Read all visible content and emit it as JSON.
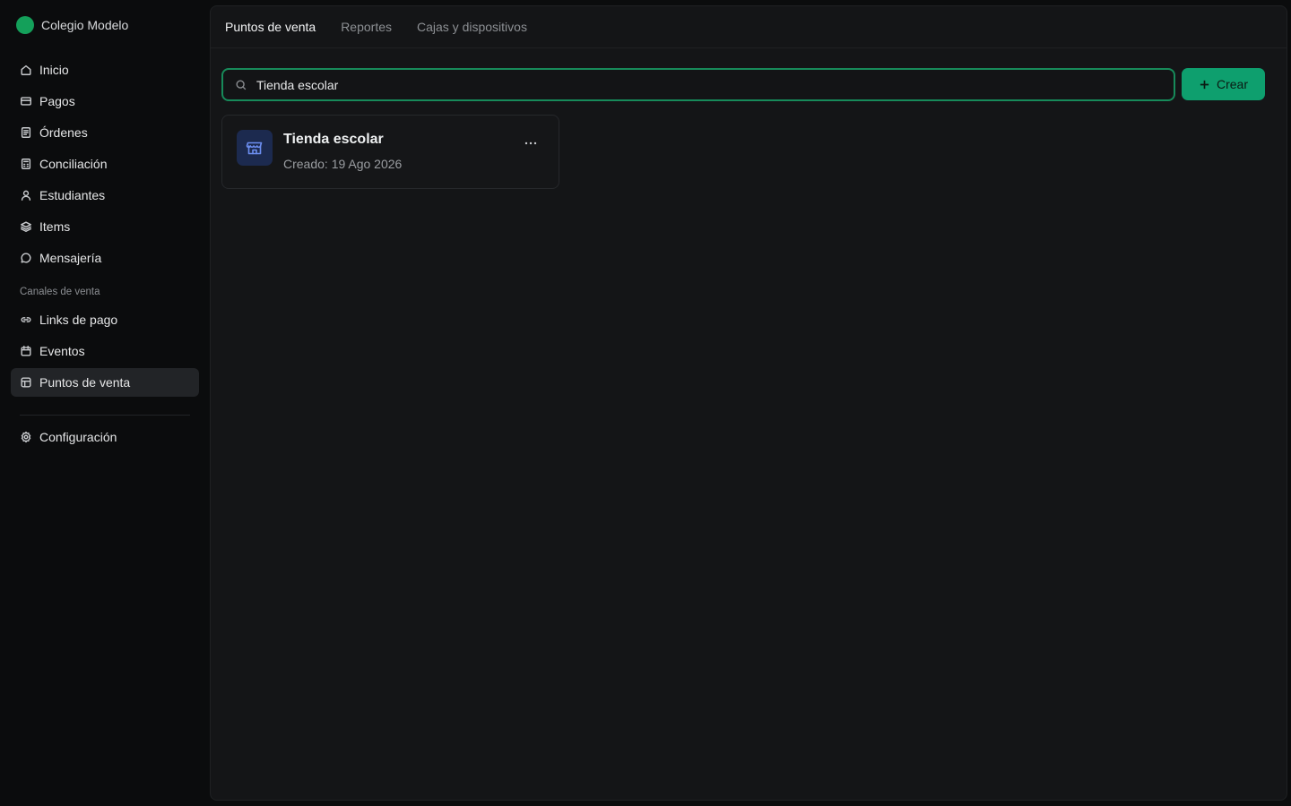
{
  "org": {
    "name": "Colegio Modelo",
    "color": "#14a05a"
  },
  "nav": {
    "main": [
      {
        "label": "Inicio",
        "icon": "home-icon"
      },
      {
        "label": "Pagos",
        "icon": "card-icon"
      },
      {
        "label": "Órdenes",
        "icon": "receipt-icon"
      },
      {
        "label": "Conciliación",
        "icon": "calculator-icon"
      },
      {
        "label": "Estudiantes",
        "icon": "user-icon"
      },
      {
        "label": "Items",
        "icon": "layers-icon"
      },
      {
        "label": "Mensajería",
        "icon": "message-icon"
      }
    ],
    "section_label": "Canales de venta",
    "channels": [
      {
        "label": "Links de pago",
        "icon": "link-icon"
      },
      {
        "label": "Eventos",
        "icon": "calendar-icon"
      },
      {
        "label": "Puntos de venta",
        "icon": "store-icon",
        "active": true
      }
    ],
    "settings": {
      "label": "Configuración",
      "icon": "gear-icon"
    }
  },
  "tabs": [
    {
      "label": "Puntos de venta",
      "active": true
    },
    {
      "label": "Reportes"
    },
    {
      "label": "Cajas y dispositivos"
    }
  ],
  "search": {
    "value": "Tienda escolar"
  },
  "create_button": {
    "label": "Crear"
  },
  "cards": [
    {
      "title": "Tienda escolar",
      "subtitle": "Creado: 19 Ago 2026",
      "icon": "store-icon"
    }
  ],
  "colors": {
    "accent": "#0e9f6e",
    "focus_border": "#178a5a",
    "icon_bg": "#1c2a4f",
    "icon_fg": "#6c8ef0"
  }
}
